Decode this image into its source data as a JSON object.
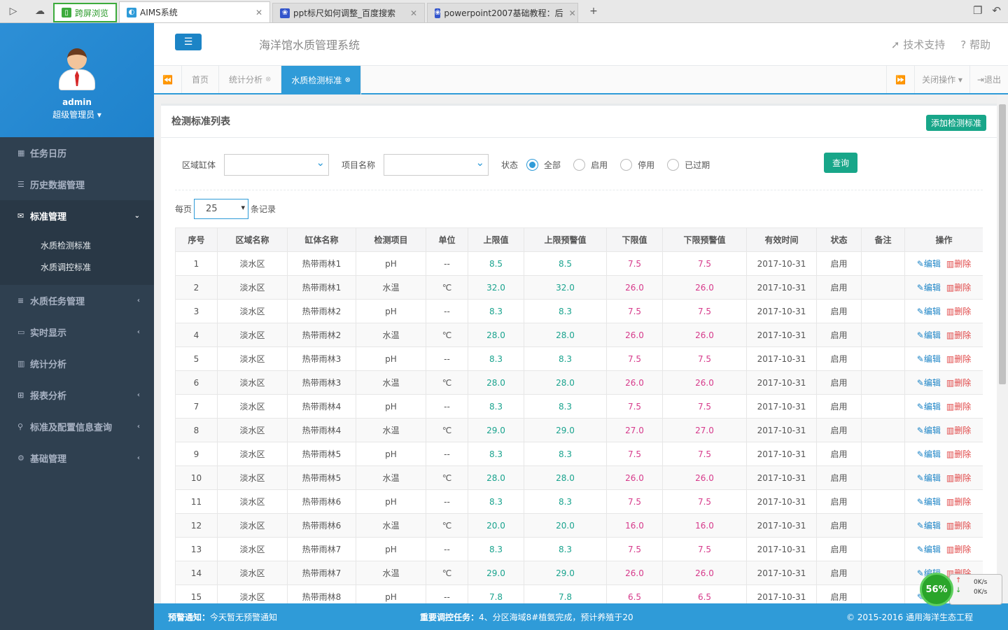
{
  "browser": {
    "tabs": [
      {
        "label": "跨屏浏览",
        "type": "green"
      },
      {
        "label": "AIMS系统",
        "active": true
      },
      {
        "label": "ppt标尺如何调整_百度搜索"
      },
      {
        "label": "powerpoint2007基础教程：后"
      }
    ],
    "new_tab": "+"
  },
  "sidebar": {
    "username": "admin",
    "role": "超级管理员 ▾",
    "items": [
      {
        "label": "任务日历",
        "icon": "calendar-icon"
      },
      {
        "label": "历史数据管理",
        "icon": "database-icon"
      },
      {
        "label": "标准管理",
        "icon": "envelope-icon",
        "active": true
      },
      {
        "label": "水质任务管理",
        "icon": "list-icon"
      },
      {
        "label": "实时显示",
        "icon": "monitor-icon"
      },
      {
        "label": "统计分析",
        "icon": "bar-chart-icon"
      },
      {
        "label": "报表分析",
        "icon": "table-icon"
      },
      {
        "label": "标准及配置信息查询",
        "icon": "search-icon"
      },
      {
        "label": "基础管理",
        "icon": "gear-icon"
      }
    ],
    "subitems": [
      "水质检测标准",
      "水质调控标准"
    ]
  },
  "header": {
    "title": "海洋馆水质管理系统",
    "support": "技术支持",
    "help": "帮助"
  },
  "tabs": {
    "items": [
      {
        "label": "首页"
      },
      {
        "label": "统计分析",
        "closable": true
      },
      {
        "label": "水质检测标准",
        "closable": true,
        "active": true
      }
    ],
    "close_ops": "关闭操作 ▾",
    "logout": "退出"
  },
  "panel": {
    "title": "检测标准列表",
    "add_button": "添加检测标准",
    "filters": {
      "region_label": "区域缸体",
      "project_label": "项目名称",
      "status_label": "状态",
      "radios": [
        "全部",
        "启用",
        "停用",
        "已过期"
      ],
      "query_button": "查询"
    },
    "per_page_prefix": "每页",
    "per_page_value": "25",
    "per_page_suffix": "条记录"
  },
  "table": {
    "headers": [
      "序号",
      "区域名称",
      "缸体名称",
      "检测项目",
      "单位",
      "上限值",
      "上限预警值",
      "下限值",
      "下限预警值",
      "有效时间",
      "状态",
      "备注",
      "操作"
    ],
    "edit_label": "编辑",
    "delete_label": "删除",
    "rows": [
      [
        "1",
        "淡水区",
        "热带雨林1",
        "pH",
        "--",
        "8.5",
        "8.5",
        "7.5",
        "7.5",
        "2017-10-31",
        "启用",
        ""
      ],
      [
        "2",
        "淡水区",
        "热带雨林1",
        "水温",
        "℃",
        "32.0",
        "32.0",
        "26.0",
        "26.0",
        "2017-10-31",
        "启用",
        ""
      ],
      [
        "3",
        "淡水区",
        "热带雨林2",
        "pH",
        "--",
        "8.3",
        "8.3",
        "7.5",
        "7.5",
        "2017-10-31",
        "启用",
        ""
      ],
      [
        "4",
        "淡水区",
        "热带雨林2",
        "水温",
        "℃",
        "28.0",
        "28.0",
        "26.0",
        "26.0",
        "2017-10-31",
        "启用",
        ""
      ],
      [
        "5",
        "淡水区",
        "热带雨林3",
        "pH",
        "--",
        "8.3",
        "8.3",
        "7.5",
        "7.5",
        "2017-10-31",
        "启用",
        ""
      ],
      [
        "6",
        "淡水区",
        "热带雨林3",
        "水温",
        "℃",
        "28.0",
        "28.0",
        "26.0",
        "26.0",
        "2017-10-31",
        "启用",
        ""
      ],
      [
        "7",
        "淡水区",
        "热带雨林4",
        "pH",
        "--",
        "8.3",
        "8.3",
        "7.5",
        "7.5",
        "2017-10-31",
        "启用",
        ""
      ],
      [
        "8",
        "淡水区",
        "热带雨林4",
        "水温",
        "℃",
        "29.0",
        "29.0",
        "27.0",
        "27.0",
        "2017-10-31",
        "启用",
        ""
      ],
      [
        "9",
        "淡水区",
        "热带雨林5",
        "pH",
        "--",
        "8.3",
        "8.3",
        "7.5",
        "7.5",
        "2017-10-31",
        "启用",
        ""
      ],
      [
        "10",
        "淡水区",
        "热带雨林5",
        "水温",
        "℃",
        "28.0",
        "28.0",
        "26.0",
        "26.0",
        "2017-10-31",
        "启用",
        ""
      ],
      [
        "11",
        "淡水区",
        "热带雨林6",
        "pH",
        "--",
        "8.3",
        "8.3",
        "7.5",
        "7.5",
        "2017-10-31",
        "启用",
        ""
      ],
      [
        "12",
        "淡水区",
        "热带雨林6",
        "水温",
        "℃",
        "20.0",
        "20.0",
        "16.0",
        "16.0",
        "2017-10-31",
        "启用",
        ""
      ],
      [
        "13",
        "淡水区",
        "热带雨林7",
        "pH",
        "--",
        "8.3",
        "8.3",
        "7.5",
        "7.5",
        "2017-10-31",
        "启用",
        ""
      ],
      [
        "14",
        "淡水区",
        "热带雨林7",
        "水温",
        "℃",
        "29.0",
        "29.0",
        "26.0",
        "26.0",
        "2017-10-31",
        "启用",
        ""
      ],
      [
        "15",
        "淡水区",
        "热带雨林8",
        "pH",
        "--",
        "7.8",
        "7.8",
        "6.5",
        "6.5",
        "2017-10-31",
        "启用",
        ""
      ]
    ]
  },
  "footer": {
    "warn_label": "预警通知：",
    "warn_text": "今天暂无预警通知",
    "task_label": "重要调控任务：",
    "task_text": "4、分区海域8#植氨完成，预计养殖于20",
    "copyright": "© 2015-2016 通用海洋生态工程"
  },
  "speed_widget": {
    "percent": "56%",
    "up": "0K/s",
    "down": "0K/s"
  },
  "colors": {
    "accent": "#2f9bd8",
    "sidebar": "#2f4050",
    "button_green": "#18a689",
    "limit_upper": "#1aa38e",
    "limit_lower": "#d63a8b"
  }
}
